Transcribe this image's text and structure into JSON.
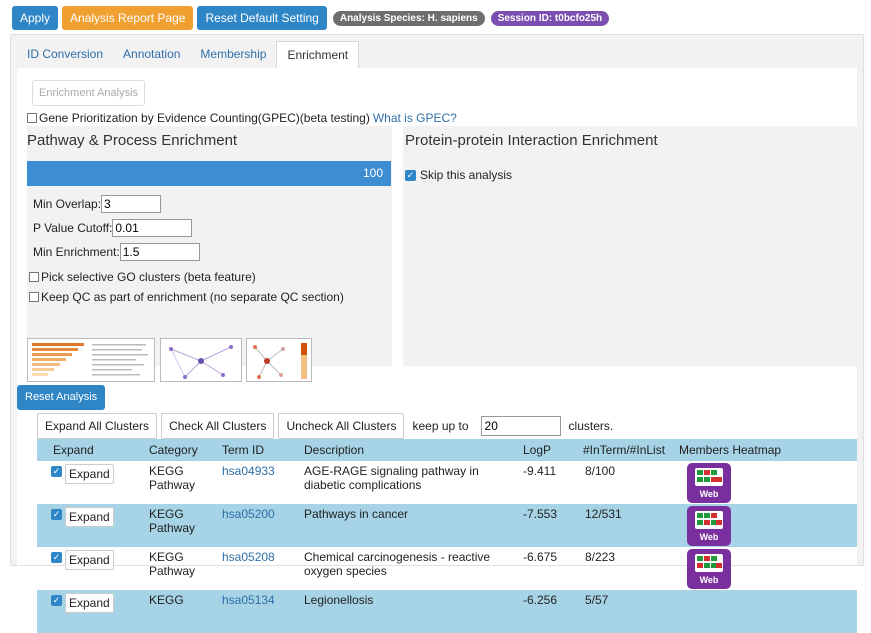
{
  "toolbar": {
    "apply": "Apply",
    "analysis_report": "Analysis Report Page",
    "reset_default": "Reset Default Setting",
    "species_badge": "Analysis Species: H. sapiens",
    "session_badge": "Session ID: t0bcfo25h"
  },
  "tabs": [
    "ID Conversion",
    "Annotation",
    "Membership",
    "Enrichment"
  ],
  "enrichment": {
    "run_button": "Enrichment Analysis",
    "gpec_label": "Gene Prioritization by Evidence Counting(GPEC)(beta testing)",
    "gpec_link": "What is GPEC?",
    "pathway_title": "Pathway & Process Enrichment",
    "slider_value": 100,
    "min_overlap_label": "Min Overlap:",
    "min_overlap": "3",
    "pvalue_label": "P Value Cutoff:",
    "pvalue": "0.01",
    "min_enrichment_label": "Min Enrichment:",
    "min_enrichment": "1.5",
    "pick_go": "Pick selective GO clusters (beta feature)",
    "keep_qc": "Keep QC as part of enrichment (no separate QC section)",
    "ppi_title": "Protein-protein Interaction Enrichment",
    "skip_label": "Skip this analysis",
    "skip_checked": true
  },
  "reset_analysis": "Reset Analysis",
  "cluster_actions": {
    "expand_all": "Expand All Clusters",
    "check_all": "Check All Clusters",
    "uncheck_all": "Uncheck All Clusters",
    "keep_up_to": "keep up to",
    "keep_value": "20",
    "clusters_suffix": "clusters."
  },
  "table": {
    "headers": [
      "Expand",
      "Category",
      "Term ID",
      "Description",
      "LogP",
      "#InTerm/#InList",
      "Members Heatmap"
    ],
    "expand_label": "Expand",
    "web_label": "Web",
    "rows": [
      {
        "category": "KEGG Pathway",
        "term_id": "hsa04933",
        "description": "AGE-RAGE signaling pathway in diabetic complications",
        "logp": "-9.411",
        "ratio": "8/100"
      },
      {
        "category": "KEGG Pathway",
        "term_id": "hsa05200",
        "description": "Pathways in cancer",
        "logp": "-7.553",
        "ratio": "12/531"
      },
      {
        "category": "KEGG Pathway",
        "term_id": "hsa05208",
        "description": "Chemical carcinogenesis - reactive oxygen species",
        "logp": "-6.675",
        "ratio": "8/223"
      },
      {
        "category": "KEGG",
        "term_id": "hsa05134",
        "description": "Legionellosis",
        "logp": "-6.256",
        "ratio": "5/57"
      }
    ]
  }
}
